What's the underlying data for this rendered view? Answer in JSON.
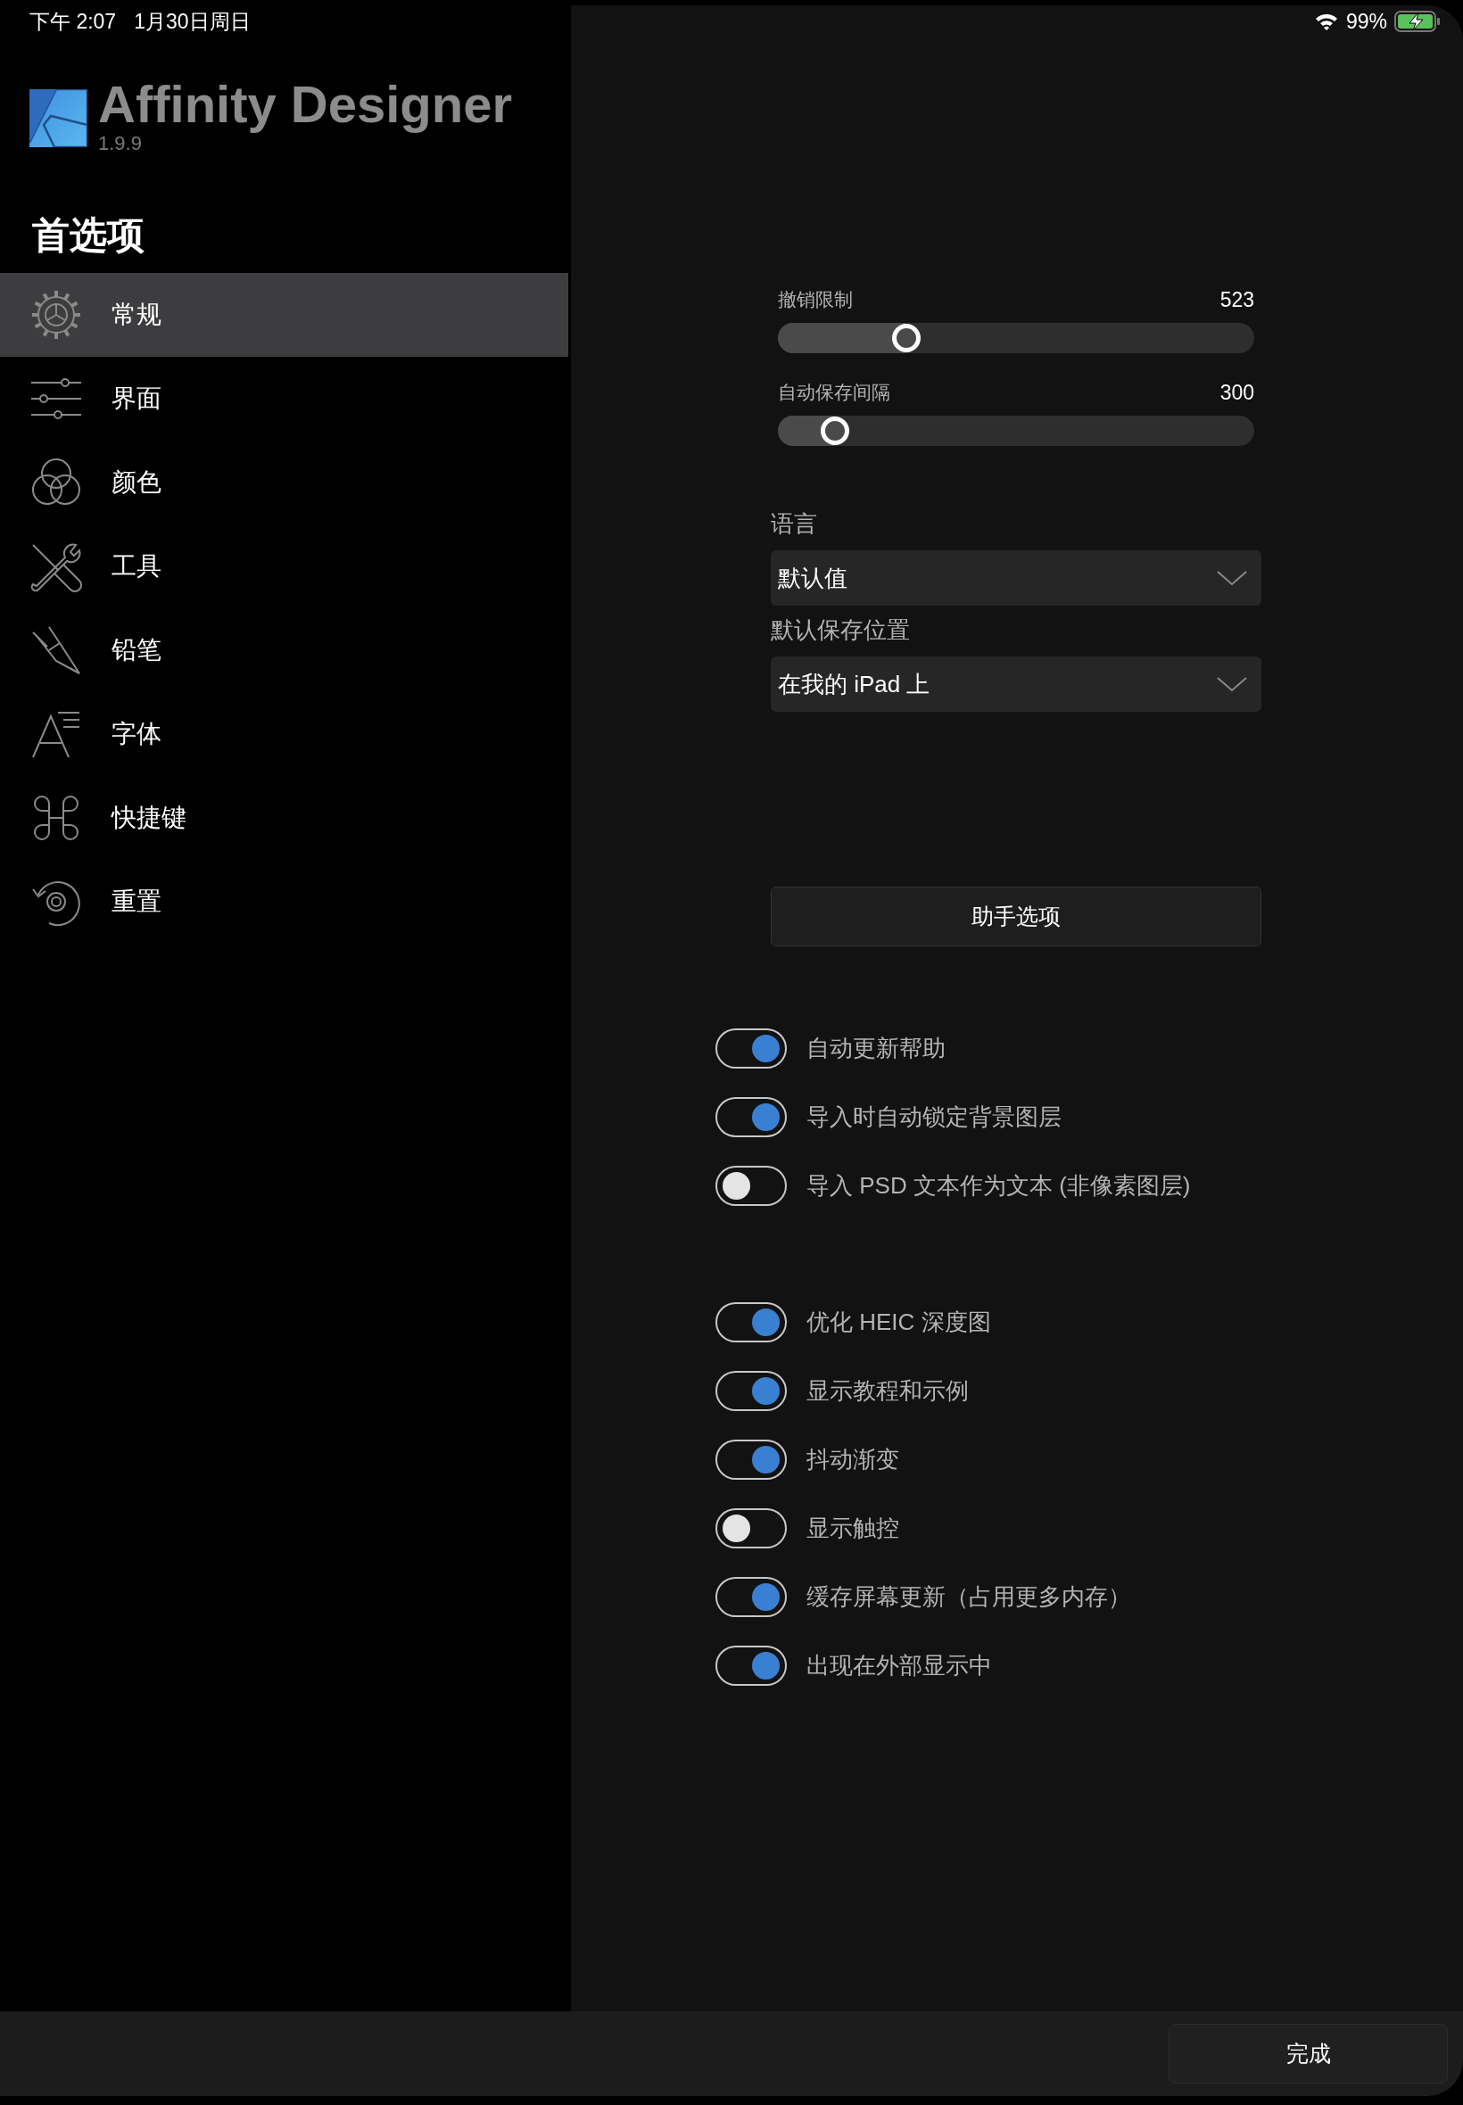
{
  "status_bar": {
    "time": "下午 2:07",
    "date": "1月30日周日",
    "battery": "99%"
  },
  "app": {
    "name": "Affinity Designer",
    "version": "1.9.9"
  },
  "sidebar": {
    "title": "首选项",
    "items": [
      {
        "label": "常规",
        "kind": "gear",
        "selected": true
      },
      {
        "label": "界面",
        "kind": "sliders",
        "selected": false
      },
      {
        "label": "颜色",
        "kind": "circles",
        "selected": false
      },
      {
        "label": "工具",
        "kind": "tools",
        "selected": false
      },
      {
        "label": "铅笔",
        "kind": "pen",
        "selected": false
      },
      {
        "label": "字体",
        "kind": "font",
        "selected": false
      },
      {
        "label": "快捷键",
        "kind": "command",
        "selected": false
      },
      {
        "label": "重置",
        "kind": "reset",
        "selected": false
      }
    ]
  },
  "sliders": [
    {
      "label": "撤销限制",
      "reading": "523",
      "level": 0.27
    },
    {
      "label": "自动保存间隔",
      "reading": "300",
      "level": 0.12
    }
  ],
  "dropdowns": [
    {
      "label": "语言",
      "value": "默认值"
    },
    {
      "label": "默认保存位置",
      "value": "在我的 iPad 上"
    }
  ],
  "assistant_button": "助手选项",
  "toggle_groups": [
    [
      {
        "label": "自动更新帮助",
        "on": true
      },
      {
        "label": "导入时自动锁定背景图层",
        "on": true
      },
      {
        "label": "导入 PSD 文本作为文本 (非像素图层)",
        "on": false
      }
    ],
    [
      {
        "label": "优化 HEIC 深度图",
        "on": true
      },
      {
        "label": "显示教程和示例",
        "on": true
      },
      {
        "label": "抖动渐变",
        "on": true
      },
      {
        "label": "显示触控",
        "on": false
      },
      {
        "label": "缓存屏幕更新（占用更多内存）",
        "on": true
      },
      {
        "label": "出现在外部显示中",
        "on": true
      }
    ]
  ],
  "done_button": "完成"
}
